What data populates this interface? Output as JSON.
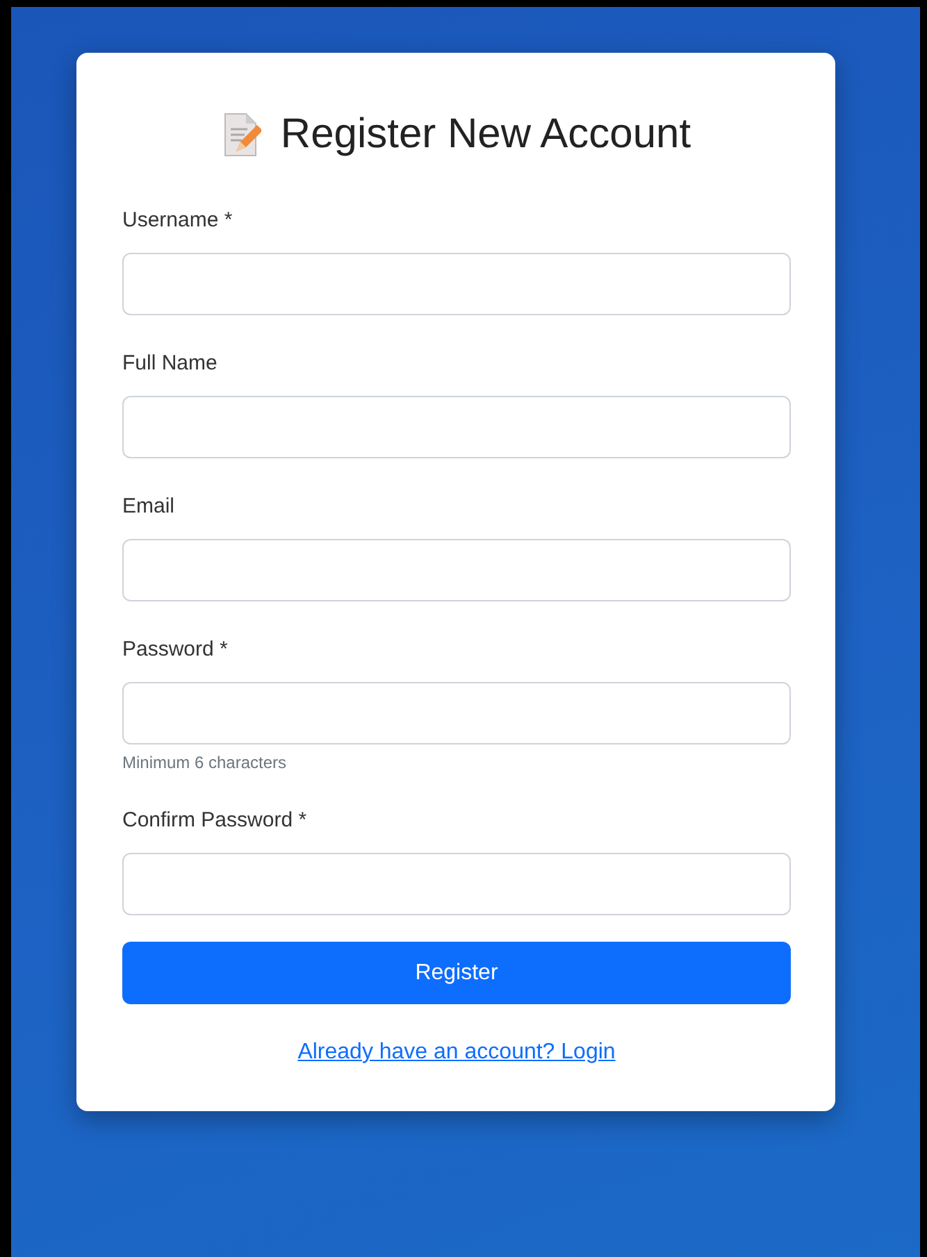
{
  "title": "Register New Account",
  "fields": [
    {
      "label": "Username *"
    },
    {
      "label": "Full Name"
    },
    {
      "label": "Email"
    },
    {
      "label": "Password *",
      "hint": "Minimum 6 characters"
    },
    {
      "label": "Confirm Password *"
    }
  ],
  "submit": "Register",
  "login_link": "Already have an account? Login"
}
